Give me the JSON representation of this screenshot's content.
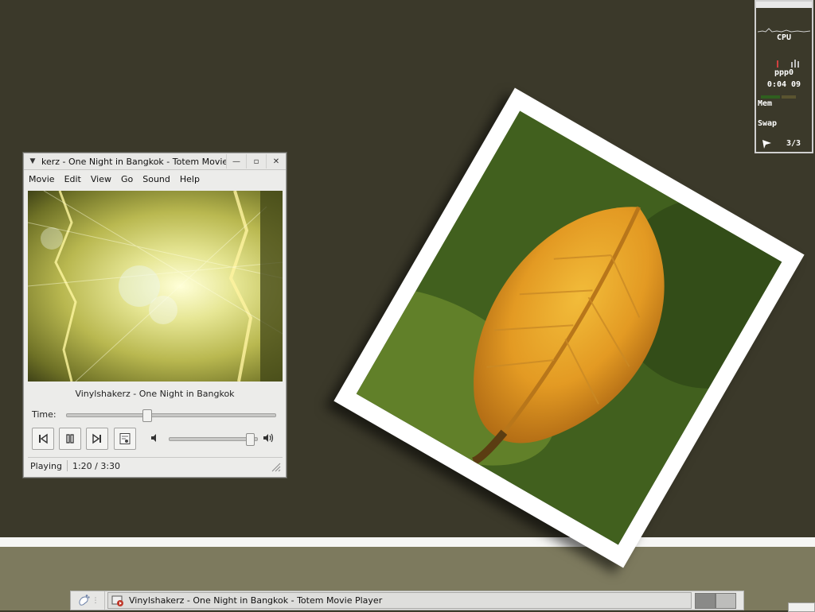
{
  "window": {
    "title": "kerz - One Night in Bangkok - Totem Movie Player",
    "menu_arrow": "▼",
    "min": "—",
    "max": "▫",
    "close": "✕"
  },
  "menubar": [
    {
      "label": "Movie",
      "key": "M"
    },
    {
      "label": "Edit",
      "key": "E"
    },
    {
      "label": "View",
      "key": "V"
    },
    {
      "label": "Go",
      "key": "G"
    },
    {
      "label": "Sound",
      "key": "S"
    },
    {
      "label": "Help",
      "key": "H"
    }
  ],
  "player": {
    "track_name": "Vinylshakerz - One Night in Bangkok",
    "time_label": "Time:",
    "progress_fraction": 0.375,
    "volume_fraction": 0.95,
    "status": "Playing",
    "time_display": "1:20 / 3:30"
  },
  "monitor": {
    "cpu_label": "CPU",
    "net_label": "ppp0",
    "uptime": "0:04 09",
    "mem_label": "Mem",
    "swap_label": "Swap",
    "workspace": "3/3"
  },
  "taskbar": {
    "task_label": "Vinylshakerz - One Night in Bangkok - Totem Movie Player"
  },
  "colors": {
    "desktop": "#3b392a",
    "shelf": "#7d7a5e"
  }
}
